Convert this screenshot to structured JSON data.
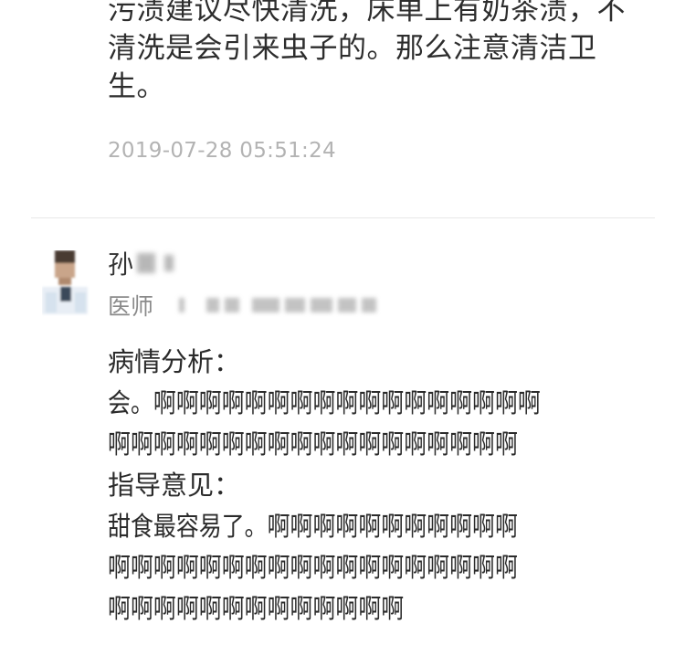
{
  "previous_reply": {
    "lines": [
      "污渍建议尽快清洗，床单上有奶茶渍，不",
      "清洗是会引来虫子的。那么注意清洁卫",
      "生。"
    ],
    "timestamp": "2019-07-28 05:51:24"
  },
  "doctor": {
    "name": "孙",
    "title": "医师",
    "avatar_icon": "doctor-avatar-icon"
  },
  "reply": {
    "analysis_heading": "病情分析：",
    "analysis_lines": [
      "会。啊啊啊啊啊啊啊啊啊啊啊啊啊啊啊啊啊",
      "啊啊啊啊啊啊啊啊啊啊啊啊啊啊啊啊啊啊"
    ],
    "advice_heading": "指导意见：",
    "advice_lines": [
      "甜食最容易了。啊啊啊啊啊啊啊啊啊啊啊",
      "啊啊啊啊啊啊啊啊啊啊啊啊啊啊啊啊啊啊",
      "啊啊啊啊啊啊啊啊啊啊啊啊啊"
    ]
  }
}
